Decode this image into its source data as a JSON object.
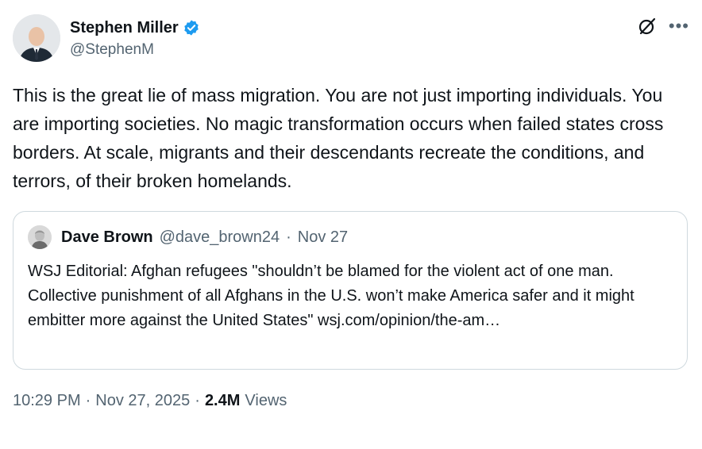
{
  "author": {
    "name": "Stephen Miller",
    "handle": "@StephenM"
  },
  "tweet": {
    "text": "This is the great lie of mass migration. You are not just importing individuals. You are importing societies. No magic transformation occurs when failed states cross borders. At scale, migrants and their descendants recreate the conditions, and terrors, of their broken homelands."
  },
  "quote": {
    "name": "Dave Brown",
    "handle": "@dave_brown24",
    "separator": "·",
    "date": "Nov 27",
    "text": "WSJ Editorial: Afghan refugees \"shouldn’t be blamed for the violent act of one man. Collective punishment of all Afghans in the U.S. won’t make America safer and it might embitter more against the United States\" wsj.com/opinion/the-am…"
  },
  "meta": {
    "time": "10:29 PM",
    "separator": "·",
    "date": "Nov 27, 2025",
    "views_count": "2.4M",
    "views_label": "Views"
  },
  "icons": {
    "verified": "verified-badge-icon",
    "grok": "grok-icon",
    "more": "more-icon"
  },
  "colors": {
    "verified_blue": "#1d9bf0",
    "secondary_text": "#536471",
    "primary_text": "#0f1419",
    "border": "#cfd9de"
  }
}
